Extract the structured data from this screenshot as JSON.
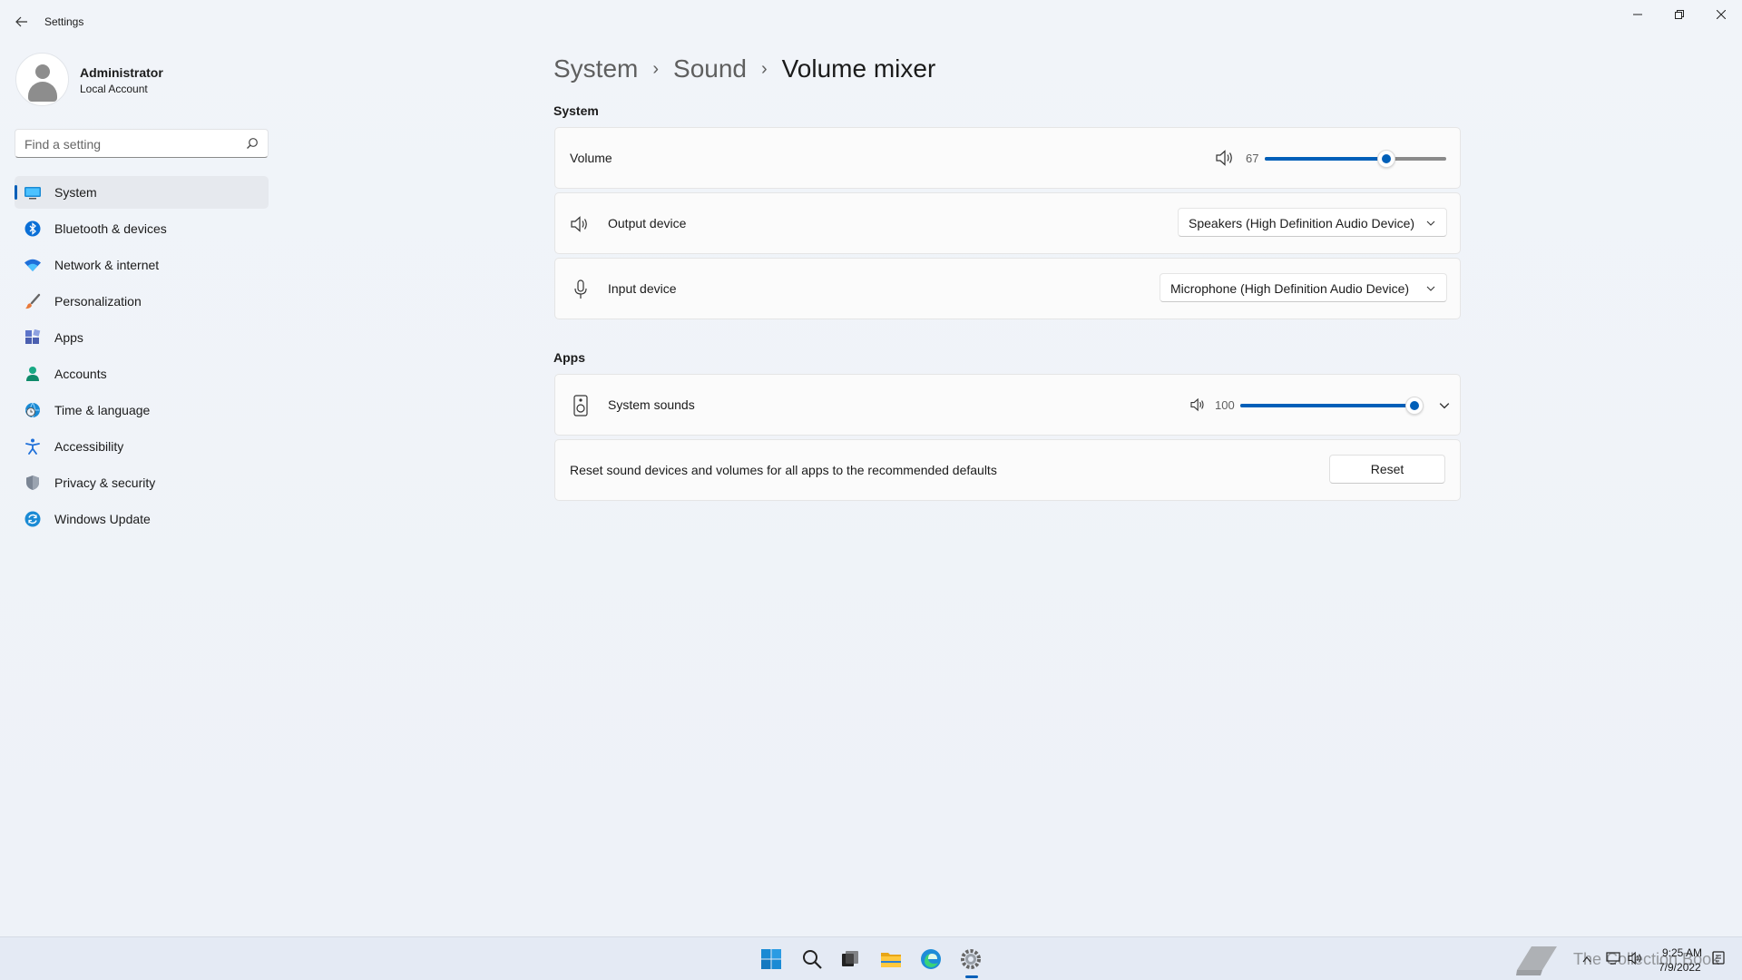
{
  "window": {
    "title": "Settings"
  },
  "profile": {
    "name": "Administrator",
    "account_type": "Local Account"
  },
  "search": {
    "placeholder": "Find a setting"
  },
  "sidebar": {
    "items": [
      {
        "label": "System",
        "icon": "system-icon",
        "active": true
      },
      {
        "label": "Bluetooth & devices",
        "icon": "bluetooth-icon"
      },
      {
        "label": "Network & internet",
        "icon": "wifi-icon"
      },
      {
        "label": "Personalization",
        "icon": "brush-icon"
      },
      {
        "label": "Apps",
        "icon": "apps-icon"
      },
      {
        "label": "Accounts",
        "icon": "accounts-icon"
      },
      {
        "label": "Time & language",
        "icon": "globe-clock-icon"
      },
      {
        "label": "Accessibility",
        "icon": "accessibility-icon"
      },
      {
        "label": "Privacy & security",
        "icon": "shield-icon"
      },
      {
        "label": "Windows Update",
        "icon": "update-icon"
      }
    ]
  },
  "breadcrumb": {
    "items": [
      "System",
      "Sound",
      "Volume mixer"
    ]
  },
  "system_section": {
    "title": "System",
    "volume": {
      "label": "Volume",
      "value": "67",
      "level": 0.67
    },
    "output": {
      "label": "Output device",
      "value": "Speakers (High Definition Audio Device)"
    },
    "input": {
      "label": "Input device",
      "value": "Microphone (High Definition Audio Device)"
    }
  },
  "apps_section": {
    "title": "Apps",
    "system_sounds": {
      "label": "System sounds",
      "value": "100",
      "level": 1.0
    },
    "reset": {
      "text": "Reset sound devices and volumes for all apps to the recommended defaults",
      "button": "Reset"
    }
  },
  "taskbar": {
    "apps": [
      "start-icon",
      "search-icon",
      "task-view-icon",
      "file-explorer-icon",
      "edge-icon",
      "settings-icon"
    ],
    "clock": {
      "time": "9:25 AM",
      "date": "7/9/2022"
    },
    "watermark": "The Collection Book"
  },
  "colors": {
    "accent": "#005fb8",
    "background": "#eef2f8",
    "card": "#fbfbfb"
  }
}
